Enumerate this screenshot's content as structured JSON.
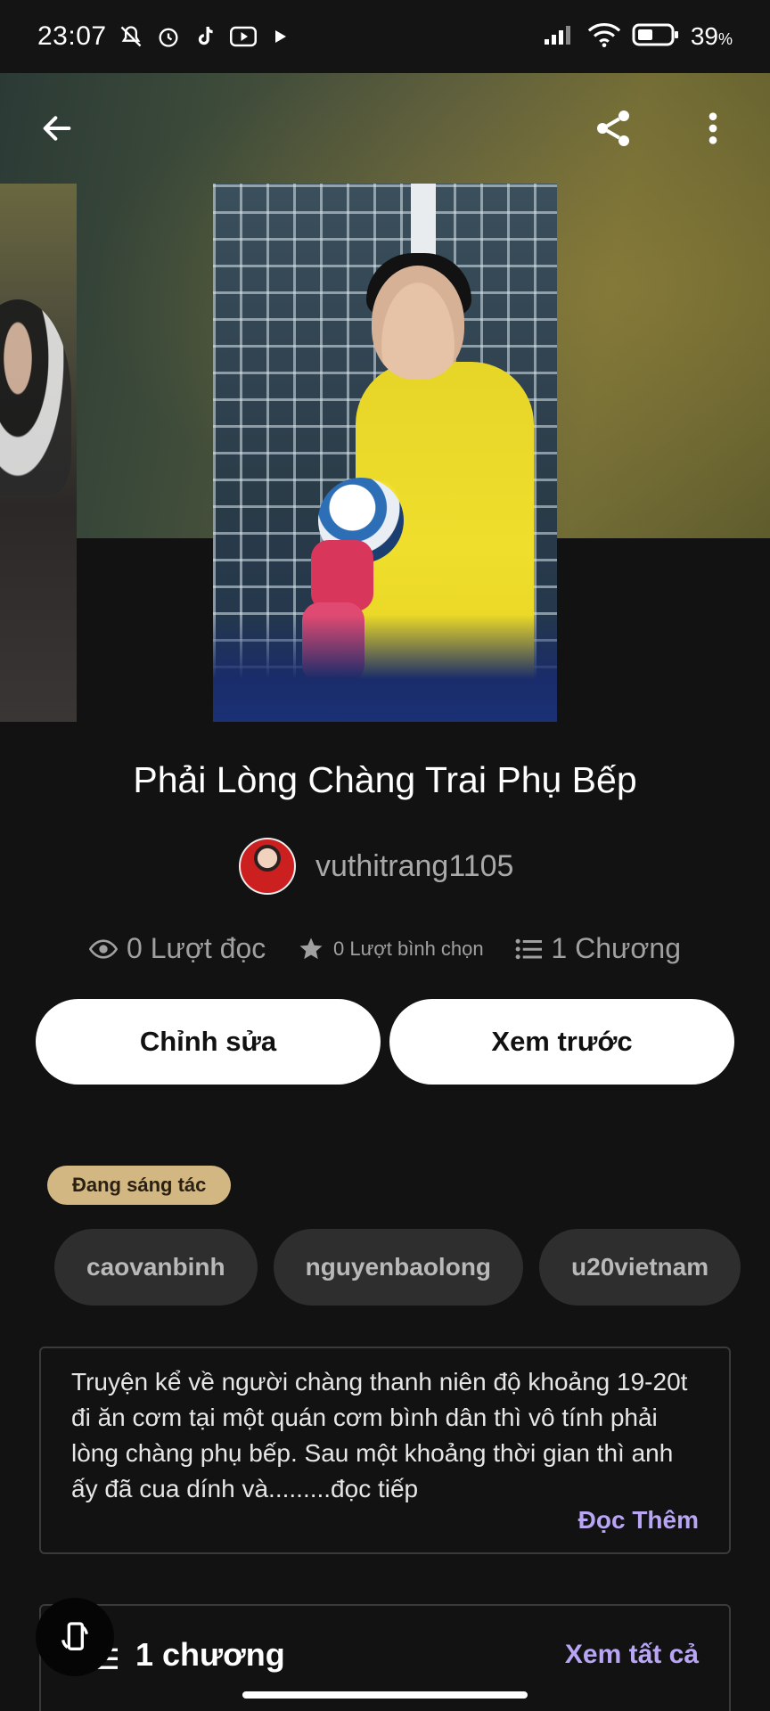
{
  "status_bar": {
    "time": "23:07",
    "battery": "39",
    "battery_unit": "%",
    "icons_left": [
      "mute-icon",
      "alarm-icon",
      "tiktok-icon",
      "youtube-icon",
      "play-icon"
    ],
    "icons_right": [
      "signal-icon",
      "wifi-icon",
      "battery-icon"
    ]
  },
  "toolbar": {
    "back": "back-arrow-icon",
    "share": "share-icon",
    "more": "more-vertical-icon"
  },
  "story": {
    "title": "Phải Lòng Chàng Trai Phụ Bếp",
    "author": "vuthitrang1105"
  },
  "stats": {
    "reads": "0 Lượt đọc",
    "votes": "0 Lượt bình chọn",
    "chapters": "1 Chương"
  },
  "actions": {
    "edit": "Chỉnh sửa",
    "preview": "Xem trước"
  },
  "status_chip": "Đang sáng tác",
  "tags": [
    "caovanbinh",
    "nguyenbaolong",
    "u20vietnam"
  ],
  "description": {
    "text": "Truyện kể về người chàng thanh niên độ khoảng 19-20t đi ăn cơm tại một quán cơm bình dân thì vô tính phải lòng chàng phụ bếp. Sau một khoảng thời gian thì anh ấy đã cua dính và.........đọc tiếp",
    "read_more": "Đọc Thêm"
  },
  "chapters": {
    "label": "1 chương",
    "see_all": "Xem tất cả"
  },
  "colors": {
    "background": "#121212",
    "accent": "#b8a6f5",
    "chip": "#d3b782"
  }
}
